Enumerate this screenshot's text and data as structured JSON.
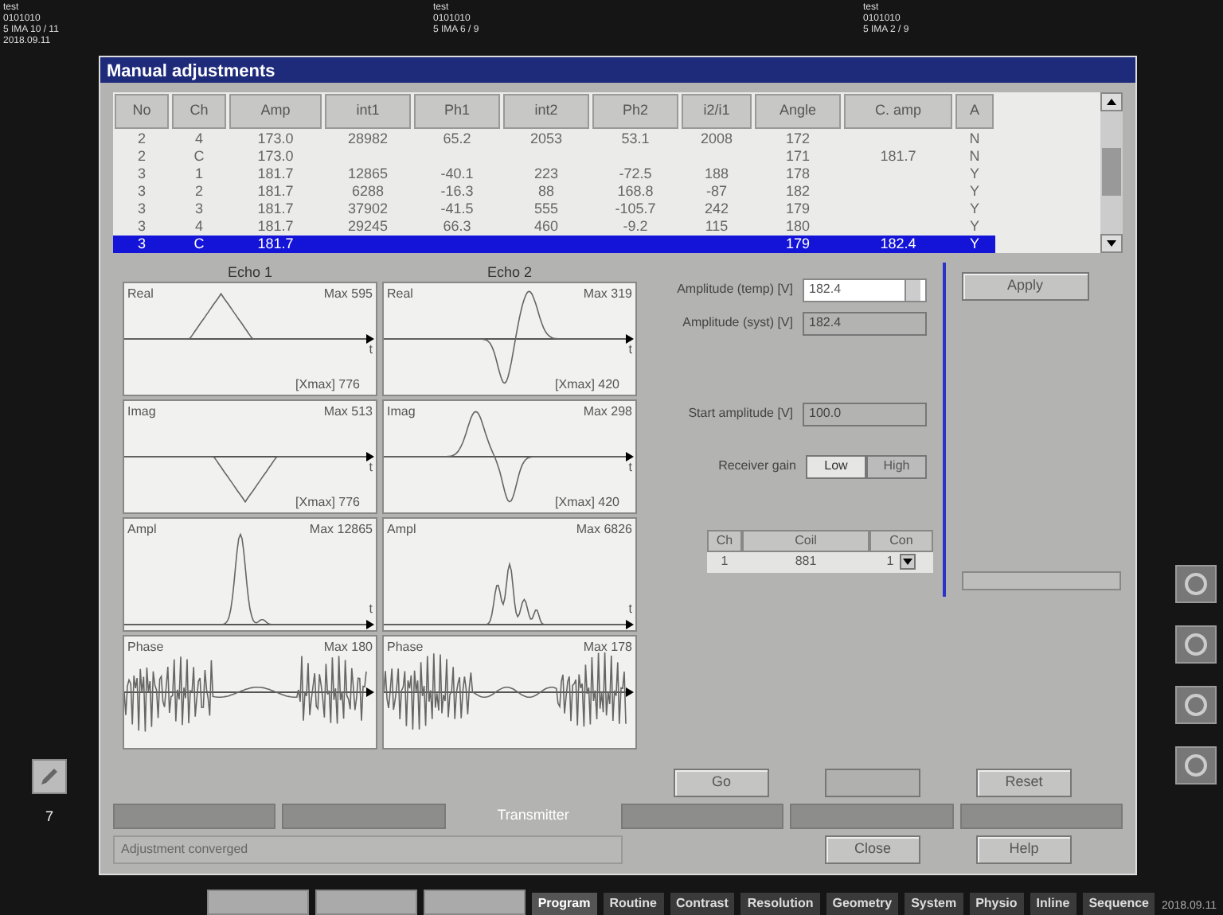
{
  "background_images": [
    {
      "lines": [
        "test",
        "0101010",
        "5 IMA 10 / 11",
        "2018.09.11"
      ]
    },
    {
      "lines": [
        "test",
        "0101010",
        "5 IMA 6 / 9"
      ]
    },
    {
      "lines": [
        "test",
        "0101010",
        "5 IMA 2 / 9"
      ]
    }
  ],
  "left_strip": {
    "row_number": "7"
  },
  "window": {
    "title": "Manual adjustments"
  },
  "table": {
    "columns": [
      "No",
      "Ch",
      "Amp",
      "int1",
      "Ph1",
      "int2",
      "Ph2",
      "i2/i1",
      "Angle",
      "C. amp",
      "A"
    ],
    "rows": [
      {
        "cells": [
          "2",
          "4",
          "173.0",
          "28982",
          "65.2",
          "2053",
          "53.1",
          "2008",
          "172",
          "",
          "N"
        ],
        "selected": false
      },
      {
        "cells": [
          "2",
          "C",
          "173.0",
          "",
          "",
          "",
          "",
          "",
          "171",
          "181.7",
          "N"
        ],
        "selected": false
      },
      {
        "cells": [
          "3",
          "1",
          "181.7",
          "12865",
          "-40.1",
          "223",
          "-72.5",
          "188",
          "178",
          "",
          "Y"
        ],
        "selected": false
      },
      {
        "cells": [
          "3",
          "2",
          "181.7",
          "6288",
          "-16.3",
          "88",
          "168.8",
          "-87",
          "182",
          "",
          "Y"
        ],
        "selected": false
      },
      {
        "cells": [
          "3",
          "3",
          "181.7",
          "37902",
          "-41.5",
          "555",
          "-105.7",
          "242",
          "179",
          "",
          "Y"
        ],
        "selected": false
      },
      {
        "cells": [
          "3",
          "4",
          "181.7",
          "29245",
          "66.3",
          "460",
          "-9.2",
          "115",
          "180",
          "",
          "Y"
        ],
        "selected": false
      },
      {
        "cells": [
          "3",
          "C",
          "181.7",
          "",
          "",
          "",
          "",
          "",
          "179",
          "182.4",
          "Y"
        ],
        "selected": true
      }
    ]
  },
  "echoes": [
    {
      "title": "Echo 1",
      "panels": [
        {
          "kind": "real",
          "label": "Real",
          "max": "Max 595",
          "xmax": "[Xmax] 776",
          "axis": "t"
        },
        {
          "kind": "imag",
          "label": "Imag",
          "max": "Max 513",
          "xmax": "[Xmax] 776",
          "axis": "t"
        },
        {
          "kind": "ampl",
          "label": "Ampl",
          "max": "Max 12865",
          "axis": "t"
        },
        {
          "kind": "phase",
          "label": "Phase",
          "max": "Max 180"
        }
      ]
    },
    {
      "title": "Echo 2",
      "panels": [
        {
          "kind": "real2",
          "label": "Real",
          "max": "Max 319",
          "xmax": "[Xmax] 420",
          "axis": "t"
        },
        {
          "kind": "imag2",
          "label": "Imag",
          "max": "Max 298",
          "xmax": "[Xmax] 420",
          "axis": "t"
        },
        {
          "kind": "ampl2",
          "label": "Ampl",
          "max": "Max 6826",
          "axis": "t"
        },
        {
          "kind": "phase2",
          "label": "Phase",
          "max": "Max 178"
        }
      ]
    }
  ],
  "fields": [
    {
      "label": "Amplitude (temp) [V]",
      "value": "182.4",
      "disabled": false,
      "spinner": true
    },
    {
      "label": "Amplitude (syst) [V]",
      "value": "182.4",
      "disabled": true,
      "spinner": false
    },
    {
      "label": "Start amplitude [V]",
      "value": "100.0",
      "disabled": true,
      "spinner": false
    }
  ],
  "receiver_gain": {
    "label": "Receiver gain",
    "options": [
      {
        "label": "Low",
        "selected": true
      },
      {
        "label": "High",
        "selected": false
      }
    ]
  },
  "coil_table": {
    "columns": [
      "Ch",
      "Coil",
      "Con"
    ],
    "rows": [
      [
        "1",
        "881",
        "1"
      ]
    ]
  },
  "apply_button": "Apply",
  "progress": {
    "level": 0
  },
  "action_buttons": [
    {
      "label": "Go",
      "disabled": false
    },
    {
      "disabled": true
    },
    {
      "label": "Reset",
      "disabled": false
    }
  ],
  "tabs": [
    {
      "selected": false
    },
    {
      "selected": false
    },
    {
      "label": "Transmitter",
      "selected": true
    },
    {
      "selected": false
    },
    {
      "selected": false
    },
    {
      "selected": false
    }
  ],
  "status": "Adjustment converged",
  "dialog_buttons": [
    "Close",
    "Help"
  ],
  "bottom_tabs": [
    {
      "label": "Program",
      "selected": true
    },
    {
      "label": "Routine",
      "selected": false
    },
    {
      "label": "Contrast",
      "selected": false
    },
    {
      "label": "Resolution",
      "selected": false
    },
    {
      "label": "Geometry",
      "selected": false
    },
    {
      "label": "System",
      "selected": false
    },
    {
      "label": "Physio",
      "selected": false
    },
    {
      "label": "Inline",
      "selected": false
    },
    {
      "label": "Sequence",
      "selected": false
    }
  ],
  "clock": "2018.09.11"
}
